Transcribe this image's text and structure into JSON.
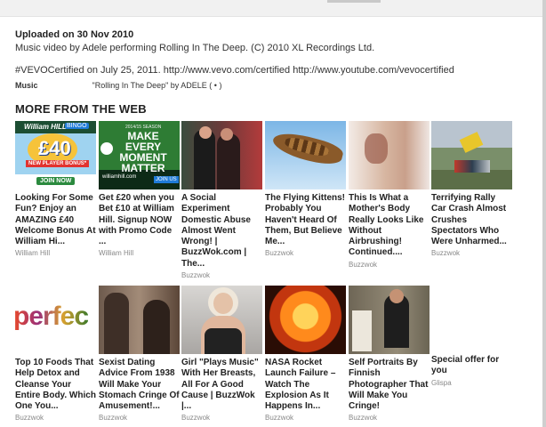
{
  "description": {
    "uploaded": "Uploaded on 30 Nov 2010",
    "line1": "Music video by Adele performing Rolling In The Deep. (C) 2010 XL Recordings Ltd.",
    "line2": "#VEVOCertified on July 25, 2011. http://www.vevo.com/certified http://www.youtube.com/vevocertified",
    "music_label": "Music",
    "music_value": "\"Rolling In The Deep\" by ADELE ( • )"
  },
  "section_title": "MORE FROM THE WEB",
  "cards": [
    {
      "title": "Looking For Some Fun? Enjoy an AMAZING £40 Welcome Bonus At William Hi...",
      "source": "William Hill",
      "thumb": {
        "logo": "William HILL",
        "badge": "BINGO",
        "amount": "£40",
        "bonus": "NEW PLAYER BONUS*",
        "join": "JOIN NOW"
      }
    },
    {
      "title": "Get £20 when you Bet £10 at William Hill. Signup NOW with Promo Code ...",
      "source": "William Hill",
      "thumb": {
        "season": "2014/15 SEASON",
        "headline": "MAKE EVERY MOMENT MATTER",
        "footer": "williamhill.com",
        "join": "JOIN US"
      }
    },
    {
      "title": "A Social Experiment Domestic Abuse Almost Went Wrong! | BuzzWok.com | The...",
      "source": "Buzzwok"
    },
    {
      "title": "The Flying Kittens! Probably You Haven't Heard Of Them, But Believe Me...",
      "source": "Buzzwok"
    },
    {
      "title": "This Is What a Mother's Body Really Looks Like Without Airbrushing! Continued....",
      "source": "Buzzwok"
    },
    {
      "title": "Terrifying Rally Car Crash Almost Crushes Spectators Who Were Unharmed...",
      "source": "Buzzwok"
    },
    {
      "title": "Top 10 Foods That Help Detox and Cleanse Your Entire Body. Which One You...",
      "source": "Buzzwok",
      "thumb": {
        "word": "perfec"
      }
    },
    {
      "title": "Sexist Dating Advice From 1938 Will Make Your Stomach Cringe Of Amusement!...",
      "source": "Buzzwok"
    },
    {
      "title": "Girl \"Plays Music\" With Her Breasts, All For A Good Cause | BuzzWok |...",
      "source": "Buzzwok"
    },
    {
      "title": "NASA Rocket Launch Failure – Watch The Explosion As It Happens In...",
      "source": "Buzzwok"
    },
    {
      "title": "Self Portraits By Finnish Photographer That Will Make You Cringe!",
      "source": "Buzzwok"
    }
  ],
  "special": {
    "title": "Special offer for you",
    "source": "Glispa"
  }
}
